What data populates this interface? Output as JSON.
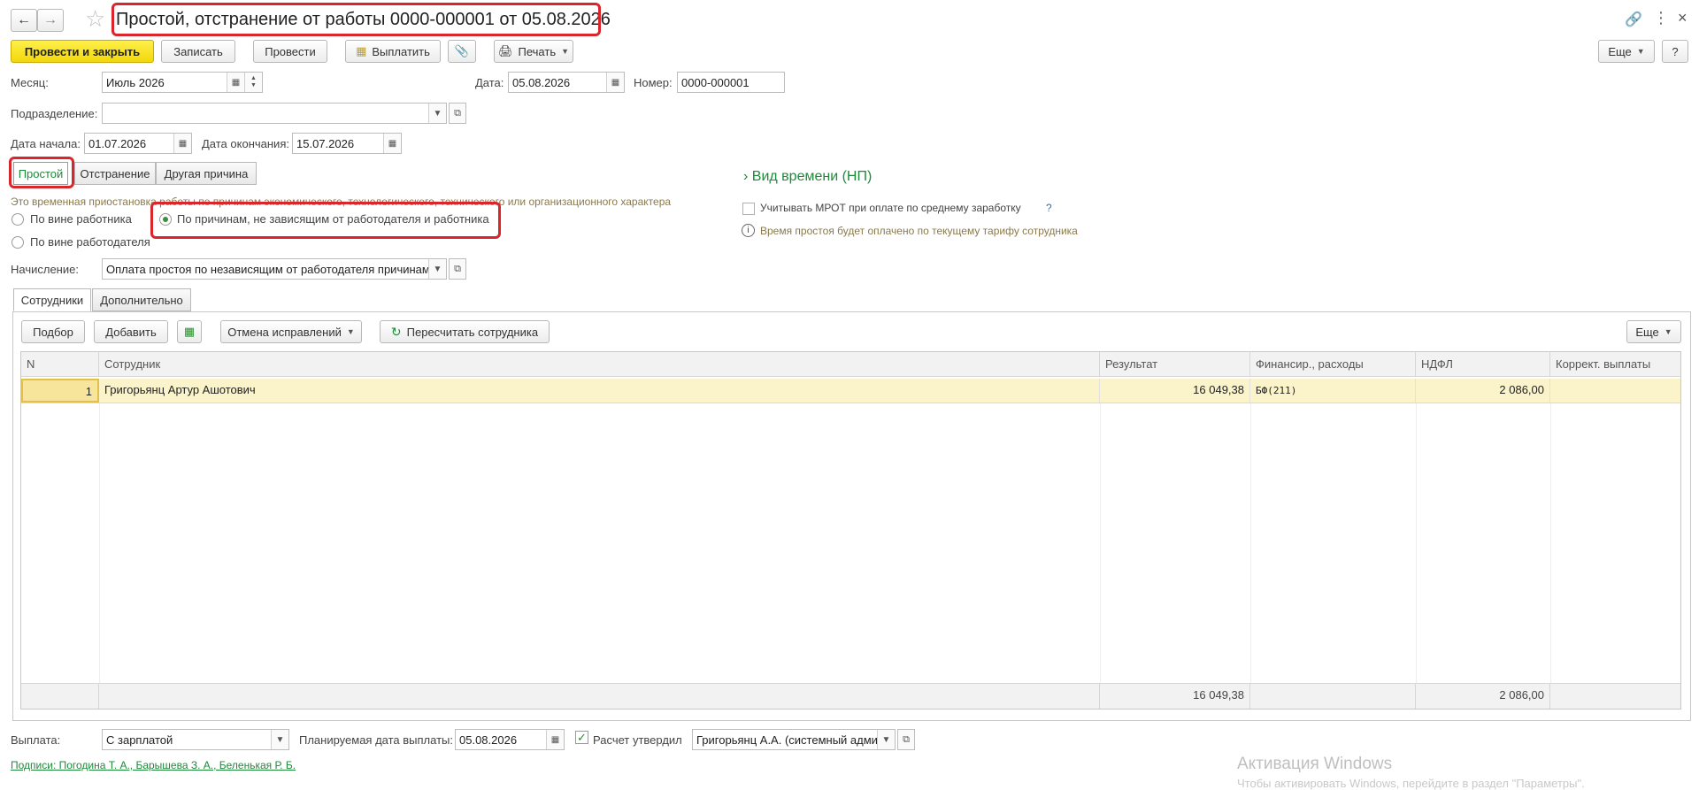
{
  "header": {
    "title": "Простой, отстранение от работы 0000-000001 от 05.08.2026"
  },
  "toolbar": {
    "post_close": "Провести и закрыть",
    "save": "Записать",
    "post": "Провести",
    "pay": "Выплатить",
    "print": "Печать",
    "more": "Еще",
    "help": "?"
  },
  "form": {
    "month_label": "Месяц:",
    "month_value": "Июль 2026",
    "date_label": "Дата:",
    "date_value": "05.08.2026",
    "number_label": "Номер:",
    "number_value": "0000-000001",
    "department_label": "Подразделение:",
    "department_value": "",
    "start_label": "Дата начала:",
    "start_value": "01.07.2026",
    "end_label": "Дата окончания:",
    "end_value": "15.07.2026"
  },
  "reason_tabs": [
    "Простой",
    "Отстранение",
    "Другая причина"
  ],
  "description": "Это временная приостановка работы по причинам экономического, технологического, технического или организационного характера",
  "radios": {
    "employee_fault": "По вине работника",
    "employer_fault": "По вине работодателя",
    "independent": "По причинам, не зависящим от работодателя и работника"
  },
  "accrual": {
    "label": "Начисление:",
    "value": "Оплата простоя по независящим от работодателя причинам"
  },
  "right_panel": {
    "time_type": "Вид времени (НП)",
    "mrot_label": "Учитывать МРОТ при оплате по среднему заработку",
    "mrot_help": "?",
    "info": "Время простоя будет оплачено по текущему тарифу сотрудника"
  },
  "section_tabs": [
    "Сотрудники",
    "Дополнительно"
  ],
  "table_toolbar": {
    "select": "Подбор",
    "add": "Добавить",
    "undo_fixes": "Отмена исправлений",
    "recalc": "Пересчитать сотрудника",
    "more": "Еще"
  },
  "table": {
    "columns": [
      "N",
      "Сотрудник",
      "Результат",
      "Финансир., расходы",
      "НДФЛ",
      "Коррект. выплаты"
    ],
    "rows": [
      {
        "n": "1",
        "employee": "Григорьянц Артур Ашотович",
        "result": "16 049,38",
        "financing": "БФ(211)",
        "ndfl": "2 086,00",
        "correction": ""
      }
    ],
    "totals": {
      "result": "16 049,38",
      "ndfl": "2 086,00"
    }
  },
  "footer": {
    "payout_label": "Выплата:",
    "payout_value": "С зарплатой",
    "planned_label": "Планируемая дата выплаты:",
    "planned_value": "05.08.2026",
    "approved_label": "Расчет утвердил",
    "approved_value": "Григорьянц А.А. (системный адми",
    "signatures": "Подписи: Погодина Т. А., Барышева З. А., Беленькая Р. Б."
  },
  "watermark": {
    "title": "Активация Windows",
    "text": "Чтобы активировать Windows, перейдите в раздел \"Параметры\"."
  },
  "colors": {
    "accent": "#1d8a3a",
    "highlight": "#d9262c",
    "row_selected": "#fbf3c9",
    "primary_button": "#f2d70a"
  }
}
